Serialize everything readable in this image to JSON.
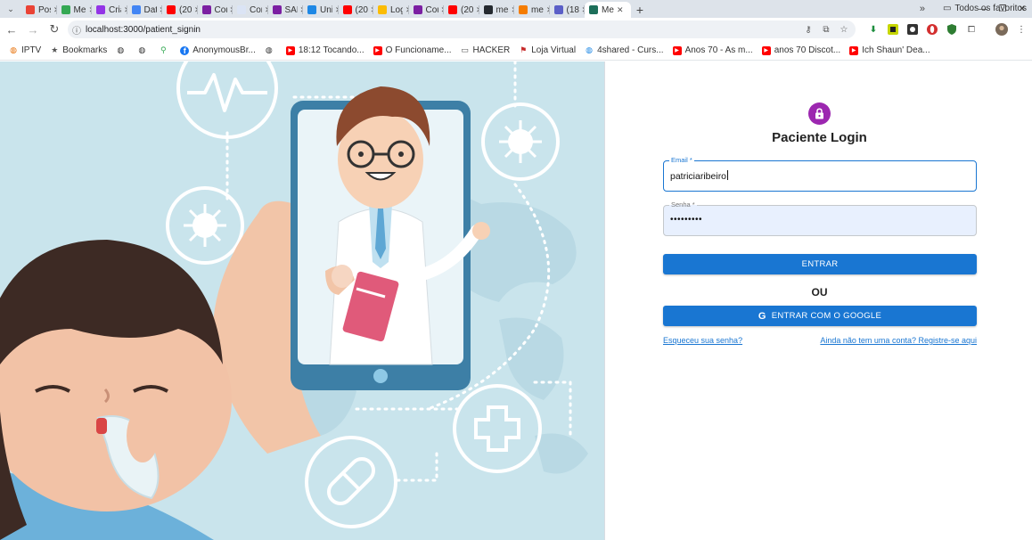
{
  "browser": {
    "tabs": [
      {
        "title": "Pos",
        "color": "#ea4335"
      },
      {
        "title": "Me",
        "color": "#34a853"
      },
      {
        "title": "Cria",
        "color": "#9334e6"
      },
      {
        "title": "Dat",
        "color": "#4285f4"
      },
      {
        "title": "(20",
        "color": "#ff0000"
      },
      {
        "title": "Cou",
        "color": "#7b1fa2"
      },
      {
        "title": "Cor",
        "color": "#dbe4f5"
      },
      {
        "title": "SAF",
        "color": "#7b1fa2"
      },
      {
        "title": "Uni",
        "color": "#1e88e5"
      },
      {
        "title": "(20",
        "color": "#ff0000"
      },
      {
        "title": "Log",
        "color": "#fbbc04"
      },
      {
        "title": "Cou",
        "color": "#7b1fa2"
      },
      {
        "title": "(20",
        "color": "#ff0000"
      },
      {
        "title": "me",
        "color": "#24292f"
      },
      {
        "title": "me",
        "color": "#f57c00"
      },
      {
        "title": "(18",
        "color": "#5b5fc7"
      }
    ],
    "active_tab": {
      "title": "Me",
      "color": "#1d6f5a"
    },
    "url": "localhost:3000/patient_signin",
    "bookmarks": [
      {
        "label": "IPTV",
        "icon": "globe-icon",
        "color": "#e8710a"
      },
      {
        "label": "Bookmarks",
        "icon": "star-icon",
        "color": "#555555"
      },
      {
        "label": "",
        "icon": "globe-icon",
        "color": "#333333"
      },
      {
        "label": "",
        "icon": "globe-icon",
        "color": "#333333"
      },
      {
        "label": "",
        "icon": "maps-icon",
        "color": "#34a853"
      },
      {
        "label": "AnonymousBr...",
        "icon": "facebook-icon",
        "color": "#1877f2"
      },
      {
        "label": "",
        "icon": "globe-icon",
        "color": "#333333"
      },
      {
        "label": "18:12 Tocando...",
        "icon": "youtube-icon",
        "color": "#ff0000"
      },
      {
        "label": "O Funcioname...",
        "icon": "youtube-icon",
        "color": "#ff0000"
      },
      {
        "label": "HACKER",
        "icon": "folder-icon",
        "color": "#555555"
      },
      {
        "label": "Loja Virtual",
        "icon": "store-icon",
        "color": "#c62828"
      },
      {
        "label": "4shared - Curs...",
        "icon": "globe-icon",
        "color": "#1e88e5"
      },
      {
        "label": "Anos 70 - As m...",
        "icon": "youtube-icon",
        "color": "#ff0000"
      },
      {
        "label": "anos 70 Discot...",
        "icon": "youtube-icon",
        "color": "#ff0000"
      },
      {
        "label": "Ich Shaun' Dea...",
        "icon": "youtube-icon",
        "color": "#ff0000"
      }
    ],
    "all_bookmarks": "Todos os favoritos"
  },
  "login": {
    "title": "Paciente Login",
    "email_label": "Email *",
    "email_value": "patriciaribeiro",
    "password_label": "Senha *",
    "password_value": "•••••••••",
    "submit": "ENTRAR",
    "or": "OU",
    "google": "ENTRAR COM O GOOGLE",
    "forgot": "Esqueceu sua senha?",
    "register": "Ainda não tem uma conta? Registre-se aqui",
    "accent": "#1976d2",
    "avatar_color": "#9c27b0"
  }
}
